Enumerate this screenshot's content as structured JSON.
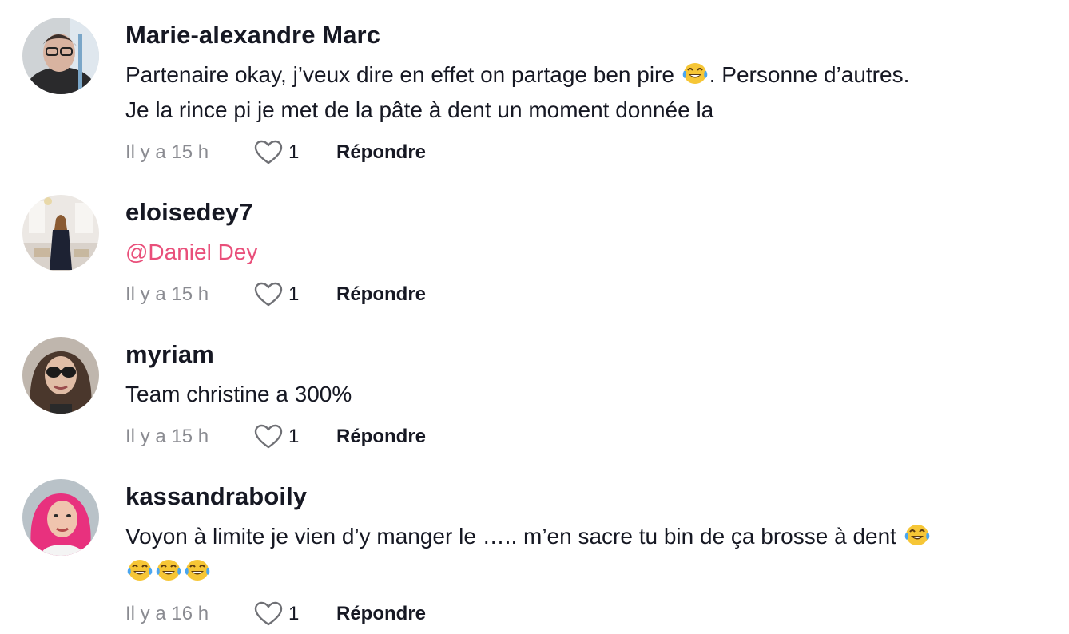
{
  "comments": [
    {
      "username": "Marie-alexandre Marc",
      "text_part1": "Partenaire okay, j’veux dire en effet on partage ben pire ",
      "emoji1": "face-with-tears-of-joy",
      "text_part2": ". Personne d’autres.",
      "text_line2": "Je la rince pi je met de la pâte à dent un moment donnée la",
      "time": "Il y a 15 h",
      "likes": "1",
      "reply_label": "Répondre"
    },
    {
      "username": "eloisedey7",
      "mention": "@Daniel Dey",
      "time": "Il y a 15 h",
      "likes": "1",
      "reply_label": "Répondre"
    },
    {
      "username": "myriam",
      "text": "Team christine a 300%",
      "time": "Il y a 15 h",
      "likes": "1",
      "reply_label": "Répondre"
    },
    {
      "username": "kassandraboily",
      "text_part1": "Voyon à limite je vien d’y manger le ….. m’en sacre tu bin de ça brosse à dent ",
      "emoji1": "face-with-tears-of-joy",
      "emoji_line2": [
        "face-with-tears-of-joy",
        "face-with-tears-of-joy",
        "face-with-tears-of-joy"
      ],
      "time": "Il y a 16 h",
      "likes": "1",
      "reply_label": "Répondre"
    }
  ],
  "colors": {
    "text": "#161823",
    "muted": "#8a8b91",
    "mention": "#e94f7a"
  },
  "icons": {
    "like": "heart-outline-icon",
    "emoji": "face-with-tears-of-joy"
  }
}
